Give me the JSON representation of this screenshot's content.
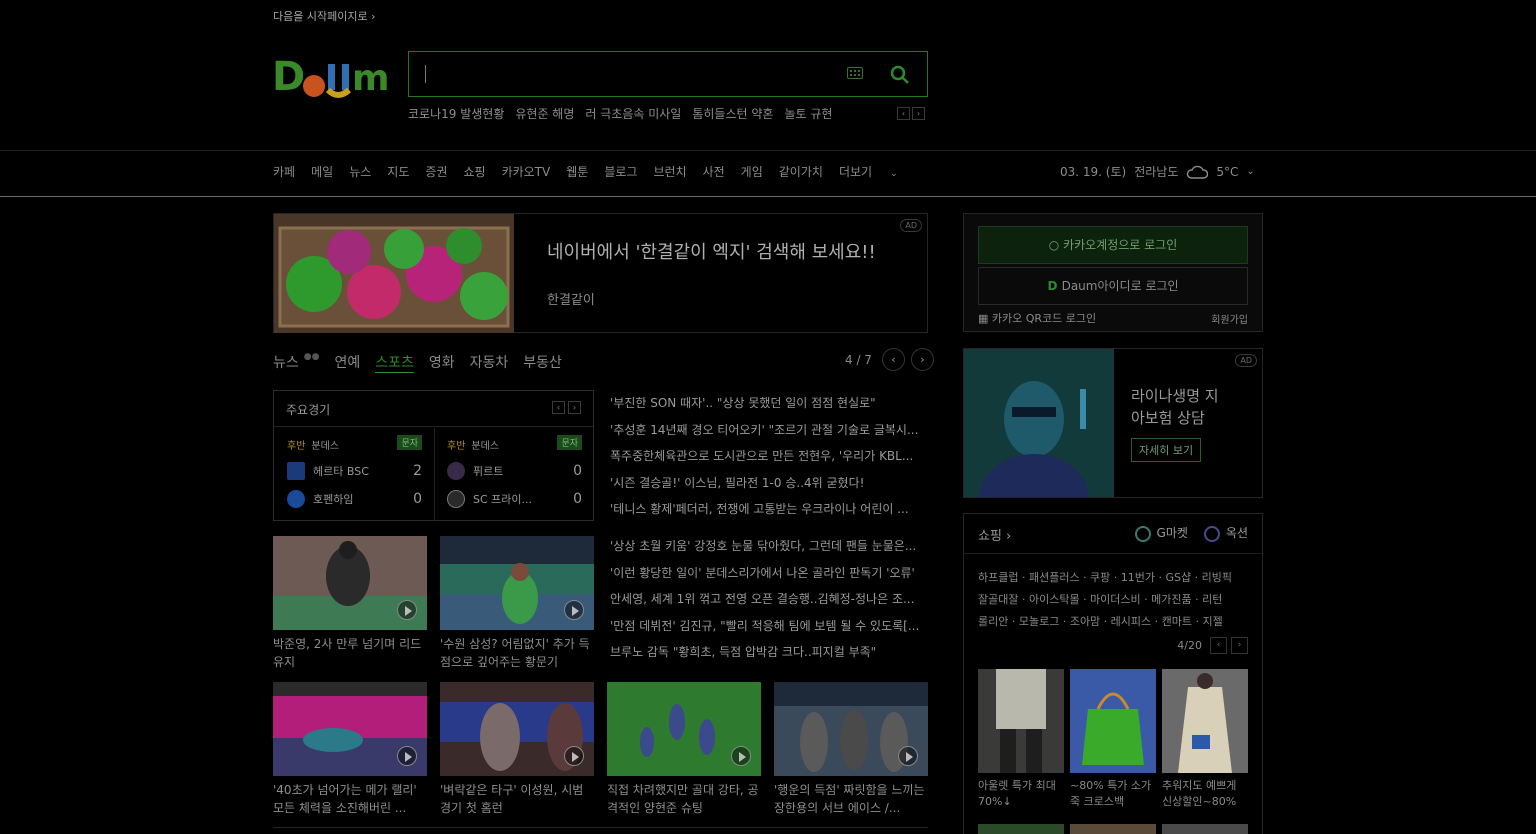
{
  "top": {
    "start_page": "다음을 시작페이지로 ›"
  },
  "search": {
    "placeholder": ""
  },
  "trending": [
    "코로나19 발생현황",
    "유현준 해명",
    "러 극초음속 미사일",
    "톰히들스턴 약혼",
    "놀토 규현"
  ],
  "gnb": {
    "items": [
      "카페",
      "메일",
      "뉴스",
      "지도",
      "증권",
      "쇼핑",
      "카카오TV",
      "웹툰",
      "블로그",
      "브런치",
      "사전",
      "게임",
      "같이가치"
    ],
    "more": "더보기",
    "date": "03. 19. (토)",
    "region": "전라남도",
    "temp": "5°C"
  },
  "ad_banner": {
    "badge": "AD",
    "title": "네이버에서 '한결같이 엑지' 검색해 보세요!!",
    "subtitle": "한결같이"
  },
  "news_tabs": {
    "items": [
      "뉴스",
      "연예",
      "스포츠",
      "영화",
      "자동차",
      "부동산"
    ],
    "active": "스포츠",
    "page": "4 / 7"
  },
  "scores": {
    "title": "주요경기",
    "games": [
      {
        "half": "후반",
        "league": "분데스",
        "tag": "문자",
        "team1": "헤르타 BSC",
        "score1": "2",
        "team2": "호펜하임",
        "score2": "0"
      },
      {
        "half": "후반",
        "league": "분데스",
        "tag": "문자",
        "team1": "퓌르트",
        "score1": "0",
        "team2": "SC 프라이...",
        "score2": "0"
      }
    ]
  },
  "headlines_top": [
    "'부진한 SON 때자'.. \"상상 못했던 일이 점점 현실로\"",
    "'추성훈 14년째 경오 티어오키' \"조르기 관절 기술로 글복시...",
    "폭주중한체육관으로 도시관으로 만든 전현우, '우리가 KBL...",
    "'시즌 결승골!' 이스님, 필라전 1-0 승..4위 굳혔다!",
    "'테니스 황제'페더러, 전쟁에 고통받는 우크라이나 어린이 ..."
  ],
  "headlines_bottom": [
    "'상상 초월 키움' 강정호 눈물 닦아줬다, 그런데 팬들 눈물은...",
    "'이런 황당한 일이' 분데스리가에서 나온 골라인 판독기 '오류'",
    "안세영, 세계 1위 꺾고 전영 오픈 결승행..김혜정-정나은 조...",
    "'만점 데뷔전' 김진규, \"빨리 적응해 팀에 보템 될 수 있도록[...",
    "브루노 감독 \"황희초, 득점 압박감 크다..피지컬 부족\""
  ],
  "thumbs_row1": [
    {
      "caption": "박준영, 2사 만루 넘기며 리드 유지"
    },
    {
      "caption": "'수원 삼성? 어림없지' 추가 득점으로 깊어주는 황문기"
    }
  ],
  "thumbs_row2": [
    {
      "caption": "'40초가 넘어가는 메가 랠리' 모든 체력을 소진해버린 ..."
    },
    {
      "caption": "'벼락같은 타구' 이성원, 시범 경기 첫 홈런"
    },
    {
      "caption": "직접 차려했지만 골대 강타, 공격적인 양현준 슈팅"
    },
    {
      "caption": "'행운의 득점' 짜릿함을 느끼는 장한용의 서브 에이스 /..."
    }
  ],
  "login": {
    "kakao": "카카오계정으로 로그인",
    "daum": "Daum아이디로 로그인",
    "qr": "카카오 QR코드 로그인",
    "signup": "회원가입"
  },
  "ad_side": {
    "badge": "AD",
    "title_line1": "라이나생명 지",
    "title_line2": "아보험 상담",
    "button": "자세히 보기"
  },
  "shopping": {
    "title": "쇼핑 ›",
    "gmarket": "G마켓",
    "auction": "옥션",
    "links": [
      "하프클럽 · 패션플러스 · 쿠팡 · 11번가 · GS샵 · 리빙픽",
      "잘골대잘 · 아이스탁몰 · 마이더스비 · 메가진품 · 리턴",
      "롤리안 · 모놀로그 · 조아맘 · 레시피스 · 캔마트 · 지젤"
    ],
    "page": "4/20",
    "products": [
      {
        "caption": "아울렛 특가 최대70%↓"
      },
      {
        "caption": "~80% 특가 소가죽 크로스백"
      },
      {
        "caption": "추워지도 예쁘게 신상할인~80%"
      }
    ]
  }
}
